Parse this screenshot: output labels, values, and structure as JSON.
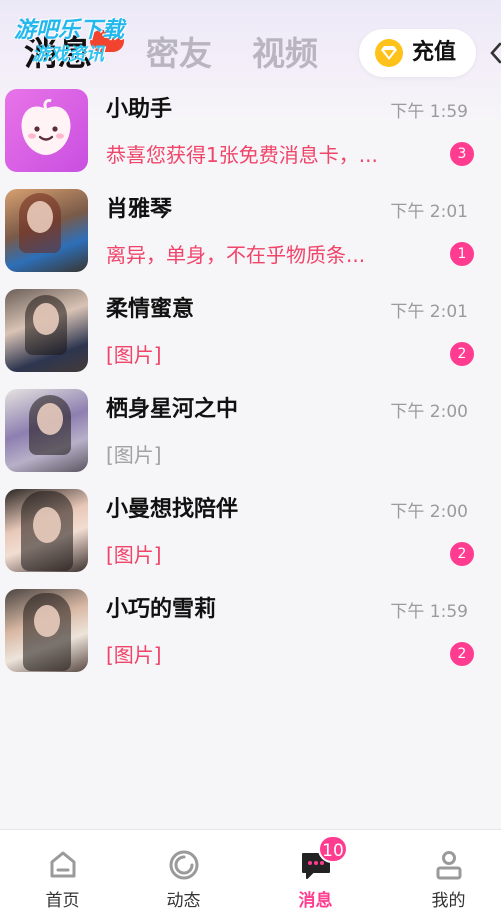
{
  "watermark": {
    "line1": "游吧乐下载",
    "line2": "游戏资讯"
  },
  "header": {
    "tabs": [
      {
        "label": "消息",
        "active": true
      },
      {
        "label": "密友",
        "active": false
      },
      {
        "label": "视频",
        "active": false
      }
    ],
    "recharge_label": "充值",
    "more_icon": "chevron-left-icon"
  },
  "conversations": [
    {
      "name": "小助手",
      "time": "下午 1:59",
      "preview": "恭喜您获得1张免费消息卡，...",
      "preview_style": "pink",
      "unread": "3"
    },
    {
      "name": "肖雅琴",
      "time": "下午 2:01",
      "preview": "离异，单身，不在乎物质条...",
      "preview_style": "pink",
      "unread": "1"
    },
    {
      "name": "柔情蜜意",
      "time": "下午 2:01",
      "preview": "[图片]",
      "preview_style": "pink",
      "unread": "2"
    },
    {
      "name": "栖身星河之中",
      "time": "下午 2:00",
      "preview": "[图片]",
      "preview_style": "gray",
      "unread": null
    },
    {
      "name": "小曼想找陪伴",
      "time": "下午 2:00",
      "preview": "[图片]",
      "preview_style": "pink",
      "unread": "2"
    },
    {
      "name": "小巧的雪莉",
      "time": "下午 1:59",
      "preview": "[图片]",
      "preview_style": "pink",
      "unread": "2"
    }
  ],
  "bottom_nav": {
    "items": [
      {
        "label": "首页",
        "icon": "home-icon",
        "active": false
      },
      {
        "label": "动态",
        "icon": "moments-icon",
        "active": false
      },
      {
        "label": "消息",
        "icon": "message-icon",
        "active": true
      },
      {
        "label": "我的",
        "icon": "profile-icon",
        "active": false
      }
    ],
    "message_badge": "10"
  },
  "colors": {
    "accent_pink": "#ff3c8f",
    "preview_pink": "#f0456a",
    "coin_yellow": "#ffc21a"
  }
}
